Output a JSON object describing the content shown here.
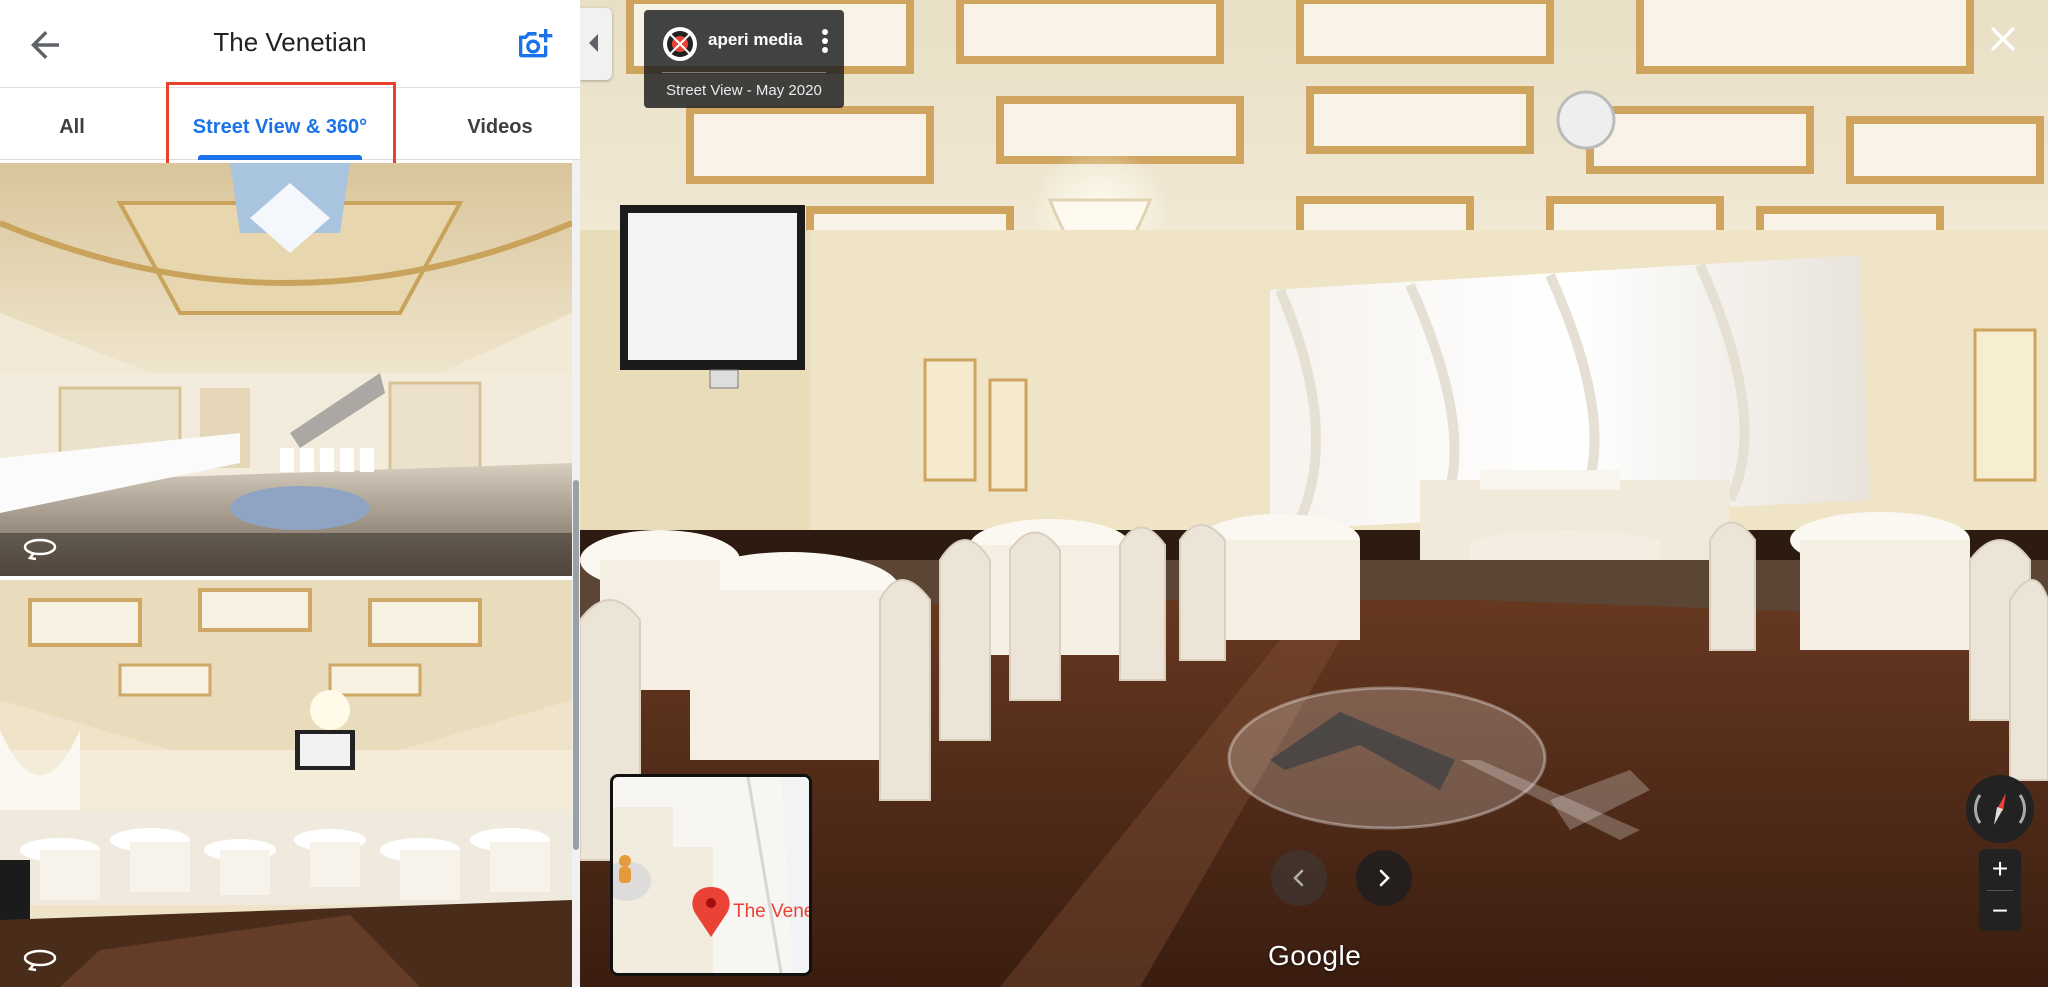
{
  "header": {
    "title": "The Venetian"
  },
  "tabs": [
    {
      "label": "All",
      "active": false
    },
    {
      "label": "Street View & 360°",
      "active": true
    },
    {
      "label": "Videos",
      "active": false
    }
  ],
  "viewer": {
    "contributor": "aperi media",
    "capture_info": "Street View - May 2020",
    "minimap_place": "The Venetian",
    "google_logo": "Google",
    "zoom_in": "+",
    "zoom_out": "−"
  },
  "colors": {
    "accent": "#1a73e8",
    "highlight": "#e8412c",
    "pin": "#ea4335"
  },
  "icons": {
    "back": "arrow-left-icon",
    "camera": "add-photo-icon",
    "close": "close-icon",
    "pano": "360-icon",
    "compass": "compass-icon"
  }
}
